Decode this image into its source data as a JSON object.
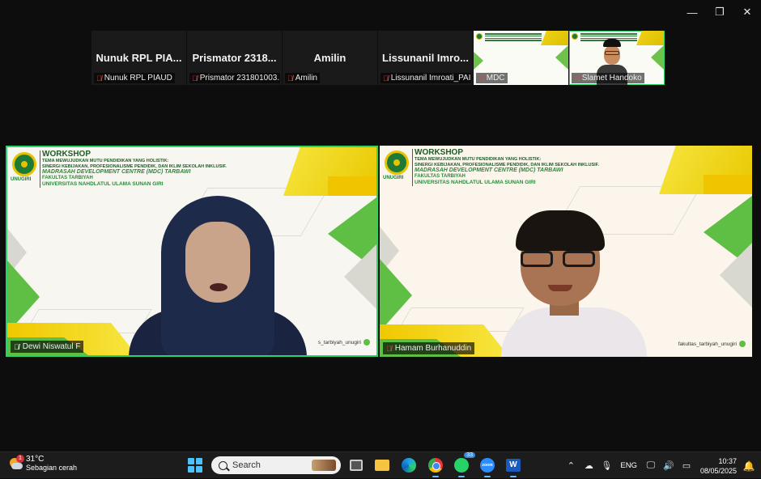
{
  "window": {
    "minimize": "—",
    "restore": "❐",
    "close": "✕"
  },
  "strip": {
    "tiles": [
      {
        "big": "Nunuk RPL PIA...",
        "small": "Nunuk RPL PIAUD"
      },
      {
        "big": "Prismator 2318...",
        "small": "Prismator 231801003."
      },
      {
        "big": "Amilin",
        "small": "Amilin"
      },
      {
        "big": "Lissunanil Imro...",
        "small": "Lissunanil Imroati_PAI"
      },
      {
        "small": "MDC"
      },
      {
        "small": "Slamet Handoko"
      }
    ]
  },
  "banner": {
    "workshop": "WORKSHOP",
    "theme1": "TEMA MEWUJUDKAN MUTU PENDIDIKAN YANG HOLISTIK:",
    "theme2": "SINERGI KEBIJAKAN, PROFESIONALISME PENDIDIK, DAN IKLIM SEKOLAH INKLUSIF.",
    "mdc": "MADRASAH DEVELOPMENT CENTRE (MDC) TARBAWI",
    "faculty": "FAKULTAS TARBIYAH",
    "university": "UNIVERSITAS NAHDLATUL ULAMA SUNAN GIRI",
    "logo_text": "UNUGIRI"
  },
  "main": {
    "left_name": "Dewi Niswatul F",
    "left_handle": "s_tarbiyah_unugiri",
    "right_name": "Hamam Burhanuddin",
    "right_handle": "fakultas_tarbiyah_unugiri"
  },
  "taskbar": {
    "weather_badge": "1",
    "temperature": "31°C",
    "condition": "Sebagian cerah",
    "search_placeholder": "Search",
    "whatsapp_badge": "33",
    "zoom_label": "zoom",
    "word_label": "W",
    "language": "ENG",
    "time": "10:37",
    "date": "08/05/2025"
  },
  "icons": {
    "up": "⌃",
    "cloud": "☁",
    "mic": "🎙",
    "monitor": "🖵",
    "speaker": "🔊",
    "battery": "▭",
    "bell": "🔔"
  }
}
